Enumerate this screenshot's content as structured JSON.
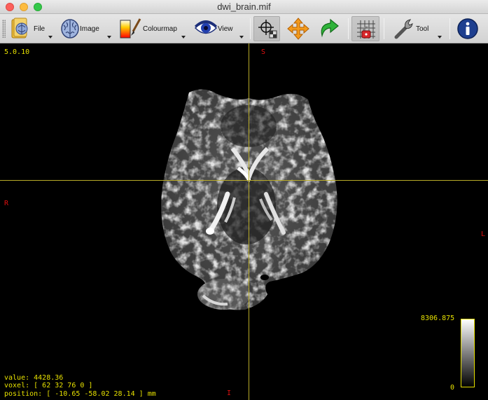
{
  "window": {
    "title": "dwi_brain.mif"
  },
  "toolbar": {
    "file": "File",
    "image": "Image",
    "colourmap": "Colourmap",
    "view": "View",
    "tool": "Tool"
  },
  "icons": {
    "file": "folder-brain-icon",
    "image": "brain-icon",
    "colourmap": "colour-gradient-brush-icon",
    "view": "eye-icon",
    "crosshair": "crosshair-icon",
    "pan": "move-arrows-icon",
    "rotate": "rotate-arrow-icon",
    "lock": "grid-lock-icon",
    "tool": "wrench-icon",
    "info": "info-icon"
  },
  "colors": {
    "overlay_text": "#e6e000",
    "orientation_labels": "#e01010",
    "crosshair": "#b9ab28"
  },
  "overlay": {
    "version": "5.0.10",
    "orientation": {
      "top": "S",
      "left": "R",
      "right": "L",
      "bottom": "I"
    },
    "value": "value: 4428.36",
    "voxel": "voxel: [ 62 32 76 0 ]",
    "position": "position: [ -10.65 -58.02 28.14 ] mm",
    "colorbar": {
      "max": "8306.875",
      "min": "0"
    }
  }
}
